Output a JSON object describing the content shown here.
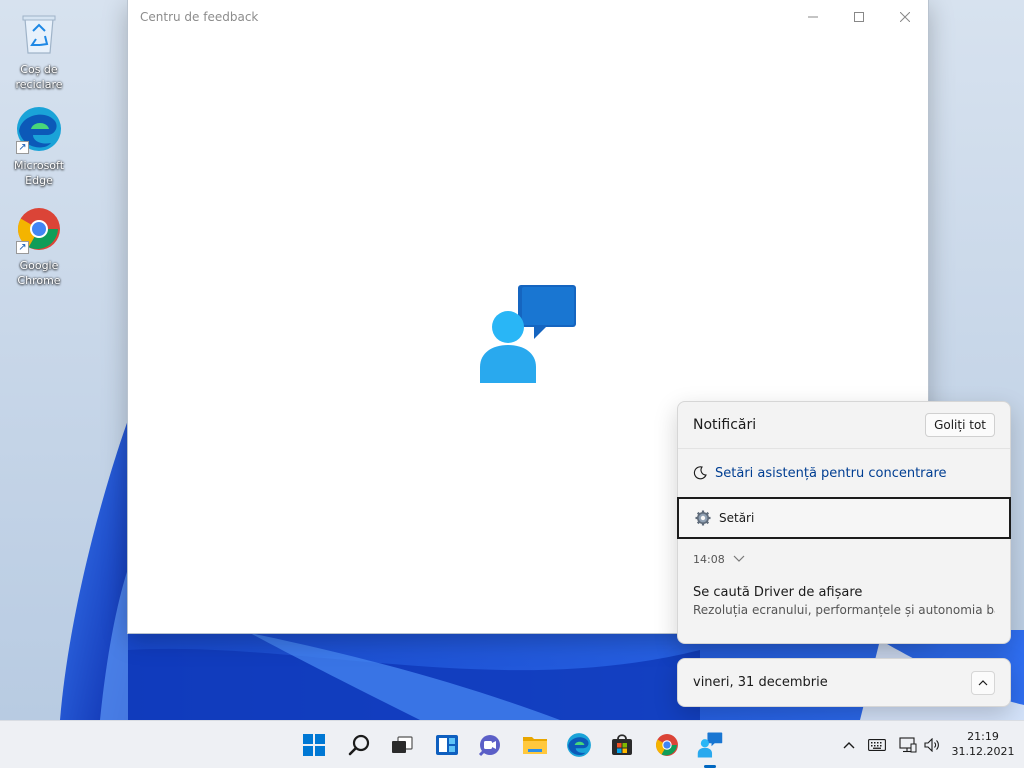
{
  "desktop": {
    "icons": [
      {
        "label": "Coș de reciclare"
      },
      {
        "label": "Microsoft Edge"
      },
      {
        "label": "Google Chrome"
      }
    ]
  },
  "app_window": {
    "title": "Centru de feedback"
  },
  "notifications": {
    "title": "Notificări",
    "clear_all_label": "Goliți tot",
    "focus_assist_label": "Setări asistență pentru concentrare",
    "settings_label": "Setări",
    "time": "14:08",
    "card_title": "Se caută Driver de afișare",
    "card_body": "Rezoluția ecranului, performanțele și autonomia bateriei"
  },
  "calendar": {
    "date": "vineri, 31 decembrie"
  },
  "taskbar": {
    "clock_time": "21:19",
    "clock_date": "31.12.2021",
    "apps": [
      "start-icon",
      "search-icon",
      "task-view-icon",
      "widgets-icon",
      "chat-icon",
      "file-explorer-icon",
      "edge-icon",
      "store-icon",
      "chrome-icon",
      "feedback-hub-icon"
    ]
  },
  "colors": {
    "accent": "#0067c0",
    "link": "#003e92",
    "wallpaper_blue": "#1a56d6"
  }
}
